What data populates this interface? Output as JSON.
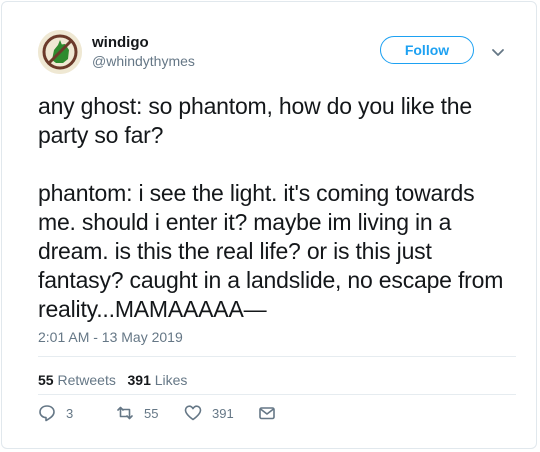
{
  "user": {
    "name": "windigo",
    "handle": "@whindythymes"
  },
  "follow_label": "Follow",
  "tweet_text": "any ghost: so phantom, how do you like the party so far?\n\nphantom: i see the light. it's coming towards me. should i enter it? maybe im living in a dream. is this the real life? or is this just fantasy? caught in a landslide, no escape from reality...MAMAAAAA—",
  "timestamp": "2:01 AM - 13 May 2019",
  "stats": {
    "retweets_count": "55",
    "retweets_label": "Retweets",
    "likes_count": "391",
    "likes_label": "Likes"
  },
  "actions": {
    "replies": "3",
    "retweets": "55",
    "likes": "391"
  },
  "colors": {
    "accent": "#1da1f2",
    "secondary_text": "#657786",
    "text": "#14171a"
  },
  "icons": [
    "no-symbol-avatar",
    "chevron-down-icon",
    "reply-icon",
    "retweet-icon",
    "heart-icon",
    "mail-icon"
  ]
}
